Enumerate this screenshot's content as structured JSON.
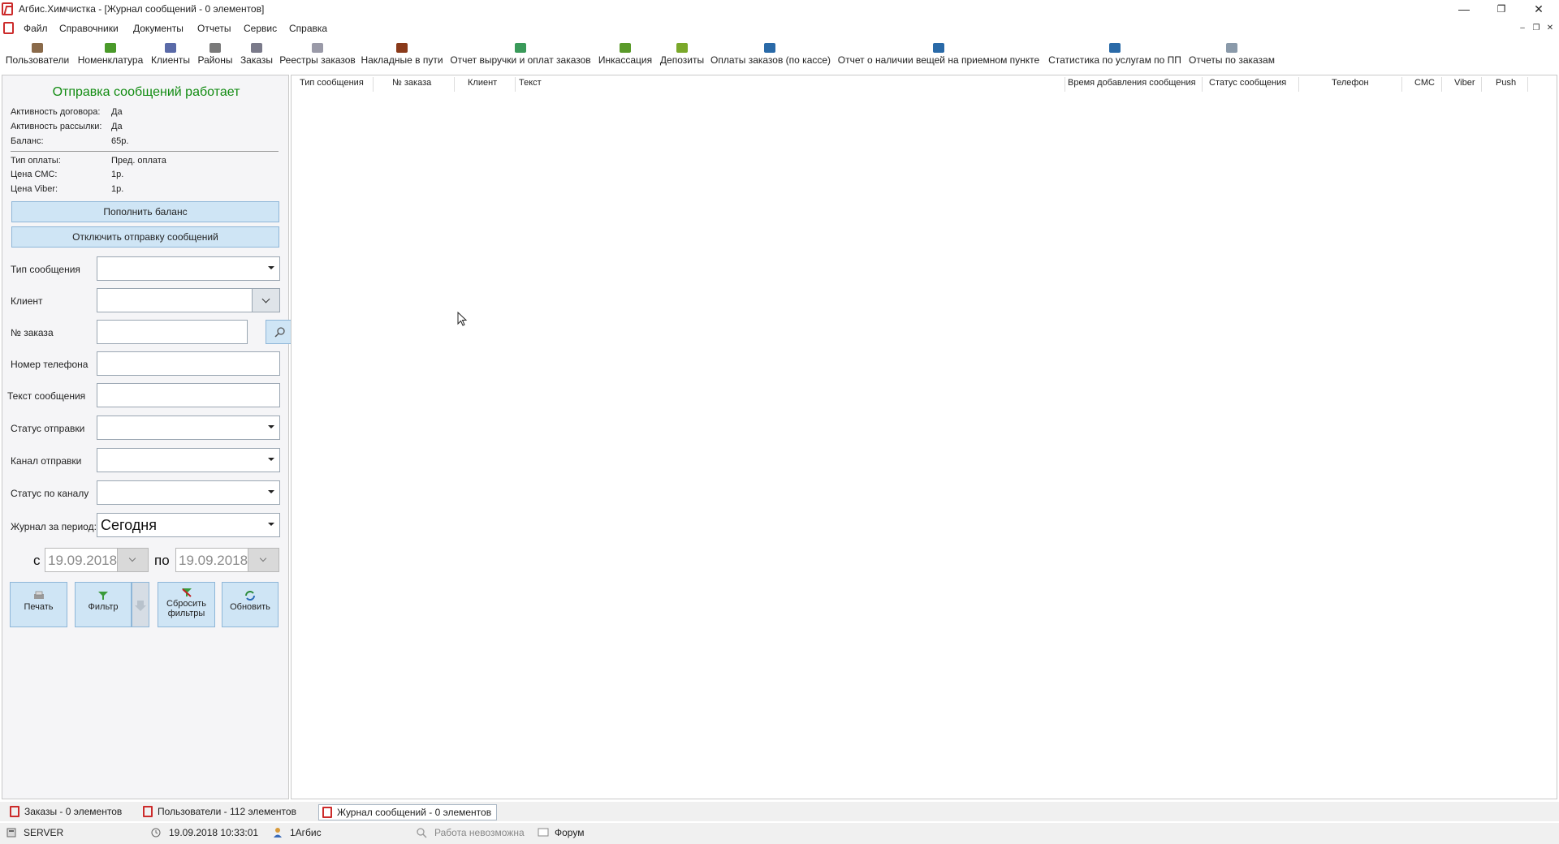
{
  "window": {
    "title": "Агбис.Химчистка - [Журнал сообщений - 0 элементов]",
    "minimize": "—",
    "restore": "❐",
    "close": "✕"
  },
  "menu": {
    "items": [
      "Файл",
      "Справочники",
      "Документы",
      "Отчеты",
      "Сервис",
      "Справка"
    ],
    "mdi_min": "–",
    "mdi_restore": "❐",
    "mdi_close": "✕"
  },
  "toolbar": {
    "items": [
      {
        "label": "Пользователи",
        "icon": "users-icon",
        "color": "#8a6a4a"
      },
      {
        "label": "Номенклатура",
        "icon": "nomenclature-icon",
        "color": "#4a9a2a"
      },
      {
        "label": "Клиенты",
        "icon": "clients-icon",
        "color": "#5a6aa8"
      },
      {
        "label": "Районы",
        "icon": "districts-icon",
        "color": "#7a7a7a"
      },
      {
        "label": "Заказы",
        "icon": "orders-icon",
        "color": "#7a7a8a"
      },
      {
        "label": "Реестры заказов",
        "icon": "order-registry-icon",
        "color": "#9a9aa8"
      },
      {
        "label": "Накладные в пути",
        "icon": "waybills-icon",
        "color": "#8a3a1a"
      },
      {
        "label": "Отчет выручки и оплат заказов",
        "icon": "revenue-report-icon",
        "color": "#3a9a5a"
      },
      {
        "label": "Инкассация",
        "icon": "collection-icon",
        "color": "#5a9a2a"
      },
      {
        "label": "Депозиты",
        "icon": "deposits-icon",
        "color": "#7aa82a"
      },
      {
        "label": "Оплаты заказов (по кассе)",
        "icon": "payments-icon",
        "color": "#2a6aa8"
      },
      {
        "label": "Отчет о наличии вещей на приемном пункте",
        "icon": "items-report-icon",
        "color": "#2a6aa8"
      },
      {
        "label": "Статистика по услугам по ПП",
        "icon": "stats-icon",
        "color": "#2a6aa8"
      },
      {
        "label": "Отчеты по заказам",
        "icon": "order-reports-icon",
        "color": "#8a9aaa"
      }
    ]
  },
  "panel": {
    "heading": "Отправка сообщений работает",
    "info1": [
      {
        "key": "Активность договора:",
        "value": "Да"
      },
      {
        "key": "Активность рассылки:",
        "value": "Да"
      },
      {
        "key": "Баланс:",
        "value": "65р."
      }
    ],
    "info2": [
      {
        "key": "Тип оплаты:",
        "value": "Пред. оплата"
      },
      {
        "key": "Цена СМС:",
        "value": "1р."
      },
      {
        "key": "Цена Viber:",
        "value": "1р."
      }
    ],
    "topup_label": "Пополнить баланс",
    "disable_label": "Отключить отправку сообщений",
    "filters": {
      "message_type_label": "Тип сообщения",
      "client_label": "Клиент",
      "order_no_label": "№ заказа",
      "phone_label": "Номер телефона",
      "text_label": "Текст сообщения",
      "send_status_label": "Статус отправки",
      "channel_label": "Канал отправки",
      "channel_status_label": "Статус по каналу",
      "period_label": "Журнал за период:",
      "period_value": "Сегодня"
    },
    "date_from_label": "с",
    "date_from": "19.09.2018",
    "date_to_label": "по",
    "date_to": "19.09.2018",
    "buttons": {
      "print": "Печать",
      "filter": "Фильтр",
      "reset": "Сбросить фильтры",
      "refresh": "Обновить"
    }
  },
  "grid": {
    "columns": [
      "Тип сообщения",
      "№ заказа",
      "Клиент",
      "Текст",
      "Время добавления сообщения",
      "Статус сообщения",
      "Телефон",
      "СМС",
      "Viber",
      "Push"
    ]
  },
  "tabs": [
    {
      "label": "Заказы - 0 элементов",
      "active": false
    },
    {
      "label": "Пользователи - 112 элементов",
      "active": false
    },
    {
      "label": "Журнал сообщений - 0 элементов",
      "active": true
    }
  ],
  "status": {
    "server": "SERVER",
    "datetime": "19.09.2018 10:33:01",
    "user": "1Агбис",
    "work": "Работа невозможна",
    "forum": "Форум"
  }
}
